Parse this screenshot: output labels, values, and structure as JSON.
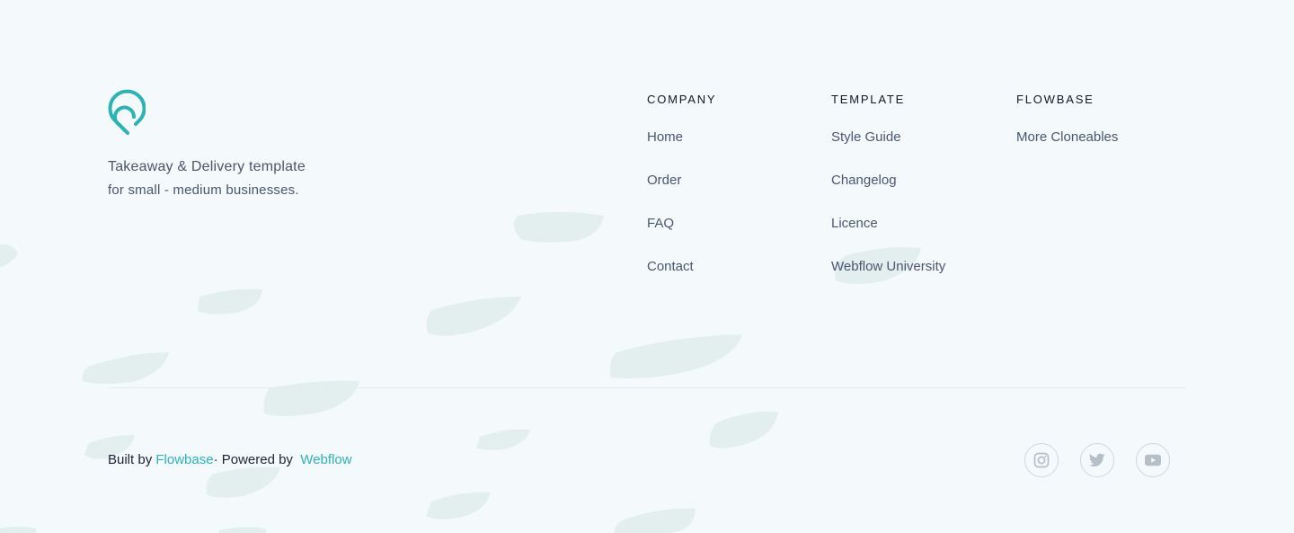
{
  "brand": {
    "logo_icon": "location-pin-logo-icon",
    "tagline_line1": "Takeaway & Delivery template",
    "tagline_line2": "for small - medium businesses.",
    "accent_color": "#2bb3b6"
  },
  "columns": [
    {
      "heading": "COMPANY",
      "links": [
        "Home",
        "Order",
        "FAQ",
        "Contact"
      ]
    },
    {
      "heading": "TEMPLATE",
      "links": [
        "Style Guide",
        "Changelog",
        "Licence",
        "Webflow University"
      ]
    },
    {
      "heading": "FLOWBASE",
      "links": [
        "More Cloneables"
      ]
    }
  ],
  "credits": {
    "built_by_prefix": "Built by ",
    "built_by_link": "Flowbase",
    "powered_by_prefix": "· Powered by  ",
    "powered_by_link": "Webflow"
  },
  "socials": [
    {
      "icon": "instagram-icon"
    },
    {
      "icon": "twitter-icon"
    },
    {
      "icon": "youtube-icon"
    }
  ],
  "colors": {
    "background": "#f4f9fc",
    "brush_strokes": "#e3eeee",
    "link_text": "#4a5670",
    "social_icon": "#b6bec8"
  }
}
